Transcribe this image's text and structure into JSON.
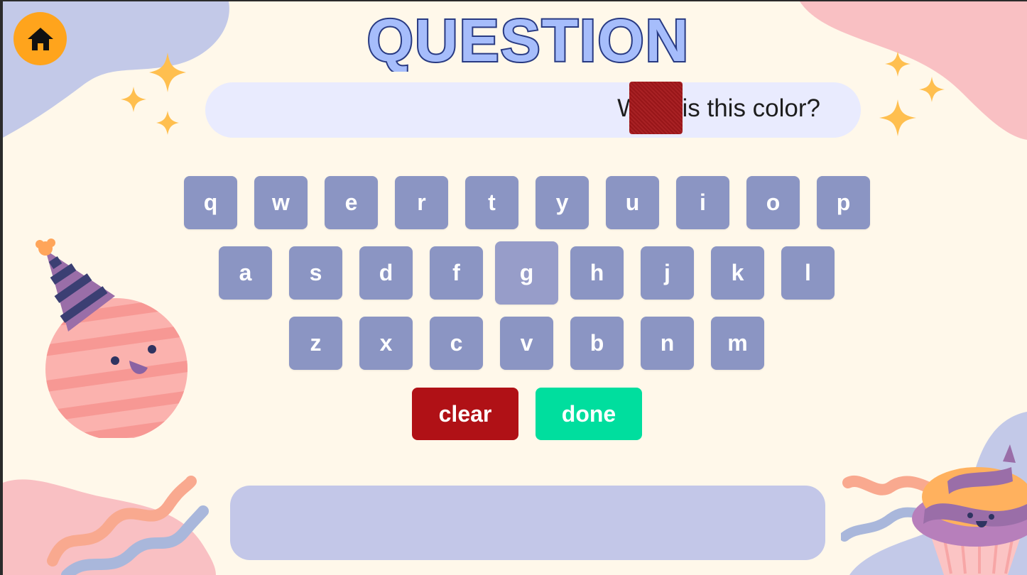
{
  "title_banner": "QUESTION",
  "question": {
    "text": "What is this color?",
    "swatch_color": "#a5181b"
  },
  "home_icon": "home-icon",
  "keyboard": {
    "rows": [
      [
        "q",
        "w",
        "e",
        "r",
        "t",
        "y",
        "u",
        "i",
        "o",
        "p"
      ],
      [
        "a",
        "s",
        "d",
        "f",
        "g",
        "h",
        "j",
        "k",
        "l"
      ],
      [
        "z",
        "x",
        "c",
        "v",
        "b",
        "n",
        "m"
      ]
    ],
    "highlighted_key": "g"
  },
  "actions": {
    "clear_label": "clear",
    "done_label": "done"
  },
  "answer": {
    "value": ""
  },
  "colors": {
    "background": "#fff8ea",
    "key": "#8b95c3",
    "clear": "#b01116",
    "done": "#00de9e",
    "home": "#ffa41c"
  }
}
